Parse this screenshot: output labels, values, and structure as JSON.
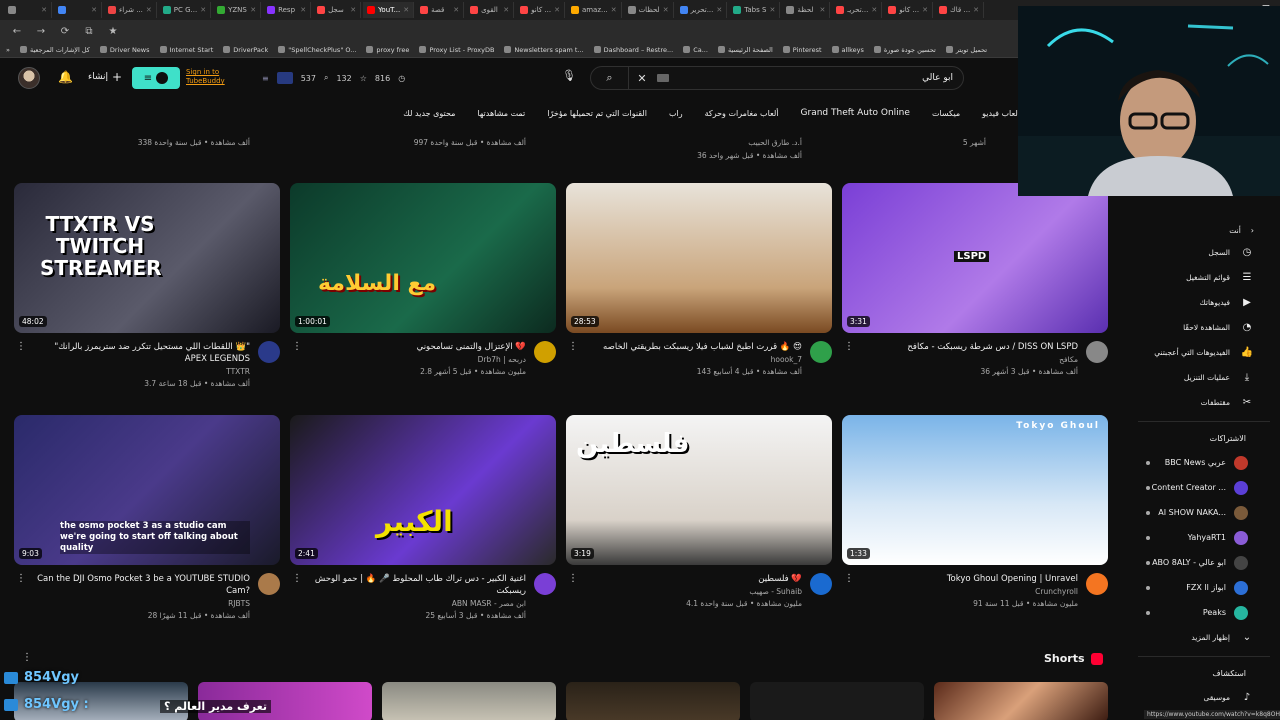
{
  "tabs": [
    {
      "label": "",
      "color": "#888"
    },
    {
      "label": "",
      "color": "#4285f4"
    },
    {
      "label": "شراء ...",
      "color": "#e44"
    },
    {
      "label": "PC G...",
      "color": "#2a8"
    },
    {
      "label": "YZNS",
      "color": "#3a3"
    },
    {
      "label": "Resp",
      "color": "#83f"
    },
    {
      "label": "سجل",
      "color": "#f44"
    },
    {
      "label": "YouT...",
      "color": "#f00"
    },
    {
      "label": "قصة",
      "color": "#f44"
    },
    {
      "label": "القوى",
      "color": "#f44"
    },
    {
      "label": "كانو ...",
      "color": "#f44"
    },
    {
      "label": "amaz...",
      "color": "#fa0"
    },
    {
      "label": "لحظات",
      "color": "#888"
    },
    {
      "label": "تحرير...",
      "color": "#4285f4"
    },
    {
      "label": "Tabs S",
      "color": "#2a8"
    },
    {
      "label": "لحظة",
      "color": "#888"
    },
    {
      "label": "تحريـ...",
      "color": "#f44"
    },
    {
      "label": "كانو ...",
      "color": "#f44"
    },
    {
      "label": "قاك ...",
      "color": "#f44"
    }
  ],
  "bookmarks": [
    "كل الإشارات المرجعية",
    "Driver News",
    "Internet Start",
    "DriverPack",
    "\"SpellCheckPlus\" O...",
    "proxy free",
    "Proxy List - ProxyDB",
    "Newsletters spam t...",
    "Dashboard – Restre...",
    "Ca...",
    "الصفحة الرئيسية",
    "Pinterest",
    "allkeys",
    "تحسين جودة صورة",
    "تحميل تويتر"
  ],
  "header": {
    "create_label": "إنشاء",
    "tubebuddy_label": "Sign in to TubeBuddy",
    "stats": [
      "537",
      "132",
      "816"
    ],
    "search_value": "ابو عالي"
  },
  "chips": [
    "ألعاب فيديو",
    "ميكسات",
    "Grand Theft Auto Online",
    "ألعاب مغامرات وحركة",
    "راب",
    "القنوات التي تم تحميلها مؤخرًا",
    "تمت مشاهدتها",
    "محتوى جديد لك"
  ],
  "partial_row": [
    {
      "line1": "",
      "line2": "338 ألف مشاهدة • قبل سنة واحدة"
    },
    {
      "line1": "",
      "line2": "997 ألف مشاهدة • قبل سنة واحدة"
    },
    {
      "line1": "أ.د. طارق الحبيب",
      "line2": "36 ألف مشاهدة • قبل شهر واحد"
    },
    {
      "line1": "",
      "line2": "5 أشهر"
    }
  ],
  "videos": [
    {
      "title": "\"اللقطات اللي مستحيل تتكرر ضد ستريمرز بالرانك 👑\" APEX LEGENDS",
      "channel": "TTXTR",
      "stats": "3.7 ألف مشاهدة • قبل 18 ساعة",
      "duration": "48:02",
      "thumb_text": "TTXTR VS TWITCH STREAMER"
    },
    {
      "title": "الإعتزال والتمنى تسامحوني 💔",
      "channel": "Drb7h | دربحه",
      "stats": "2.8 مليون مشاهدة • قبل 5 أشهر",
      "duration": "1:00:01",
      "thumb_text": "مع السلامة"
    },
    {
      "title": "قررت اطبخ لشباب فيلا ريسبكت بطريقتي الخاصه 🔥 😍",
      "channel": "hoook_7",
      "stats": "143 ألف مشاهدة • قبل 4 أسابيع",
      "duration": "28:53",
      "thumb_text": ""
    },
    {
      "title": "دس شرطة ريسبكت - مكافح / DISS ON LSPD",
      "channel": "مكافح",
      "stats": "36 ألف مشاهدة • قبل 3 أشهر",
      "duration": "3:31",
      "thumb_text": "LSPD"
    },
    {
      "title": "Can the DJI Osmo Pocket 3 be a YOUTUBE STUDIO Cam?",
      "channel": "RJBTS",
      "stats": "28 ألف مشاهدة • قبل 11 شهرًا",
      "duration": "9:03",
      "thumb_text": "the osmo pocket 3 as a studio cam we're going to start off talking about quality"
    },
    {
      "title": "اغنية الكبير - دس تراك طاب المحلوط 🎤 🔥 | حمو الوحش ريسبكت",
      "channel": "ABN MASR - ابن مصر",
      "stats": "25 ألف مشاهدة • قبل 3 أسابيع",
      "duration": "2:41",
      "thumb_text": "الكبير"
    },
    {
      "title": "فلسطين 💔",
      "channel": "صهيب - Suhaib",
      "stats": "4.1 مليون مشاهدة • قبل سنة واحدة",
      "duration": "3:19",
      "thumb_text": "فلسطين"
    },
    {
      "title": "Tokyo Ghoul Opening | Unravel",
      "channel": "Crunchyroll",
      "stats": "91 مليون مشاهدة • قبل 11 سنة",
      "duration": "1:33",
      "thumb_text": "Tokyo Ghoul"
    }
  ],
  "sidebar": {
    "you_label": "أنت",
    "items": [
      "السجل",
      "قوائم التشغيل",
      "فيديوهاتك",
      "المشاهدة لاحقًا",
      "الفيديوهات التي أعجبتني",
      "عمليات التنزيل",
      "مقتطفات"
    ],
    "subs_heading": "الاشتراكات",
    "subs": [
      {
        "name": "BBC News عربي",
        "color": "#c0392b"
      },
      {
        "name": "Content Creator ...",
        "color": "#5b3fd6"
      },
      {
        "name": "AI SHOW NAKA...",
        "color": "#7a5a3a"
      },
      {
        "name": "YahyaRT1",
        "color": "#8a5cd6"
      },
      {
        "name": "ABO 8ALY - ابو عالي",
        "color": "#444"
      },
      {
        "name": "FZX ll ابواز",
        "color": "#2c6fd6"
      },
      {
        "name": "Peaks",
        "color": "#26b6a0"
      }
    ],
    "show_more": "إظهار المزيد",
    "explore_heading": "استكشاف",
    "explore_first": "موسيقى"
  },
  "shorts_label": "Shorts",
  "overlay": {
    "name_top": "854Vgy",
    "name_bottom": "854Vgy :",
    "arabic_caption": "تعرف مدير العالم ؟"
  },
  "status_url": "https://www.youtube.com/watch?v=k8q8OHr5W"
}
